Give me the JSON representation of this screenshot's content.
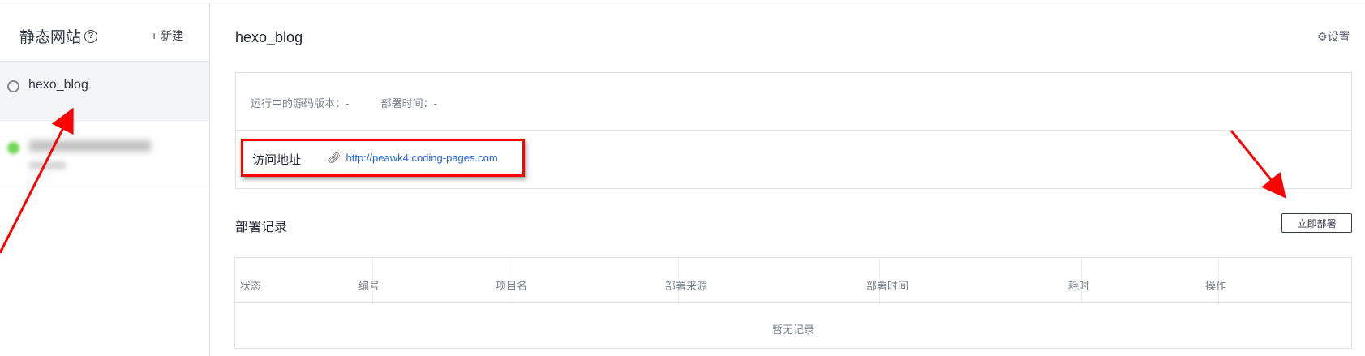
{
  "sidebar": {
    "title": "静态网站",
    "help_icon": "?",
    "new_label": "+ 新建",
    "items": [
      {
        "label": "hexo_blog",
        "status": "inactive"
      },
      {
        "label": "",
        "status": "running"
      }
    ]
  },
  "main": {
    "title": "hexo_blog",
    "settings_label": "设置",
    "source_version_label": "运行中的源码版本：-",
    "deploy_time_label": "部署时间：-",
    "visit_label": "访问地址",
    "visit_url": "http://peawk4.coding-pages.com",
    "deploy_records_title": "部署记录",
    "deploy_now_label": "立即部署",
    "table": {
      "columns": [
        "状态",
        "编号",
        "项目名",
        "部署来源",
        "部署时间",
        "耗时",
        "操作"
      ],
      "empty_text": "暂无记录"
    }
  },
  "colors": {
    "link": "#2162e4",
    "annotation": "#ff0000"
  }
}
